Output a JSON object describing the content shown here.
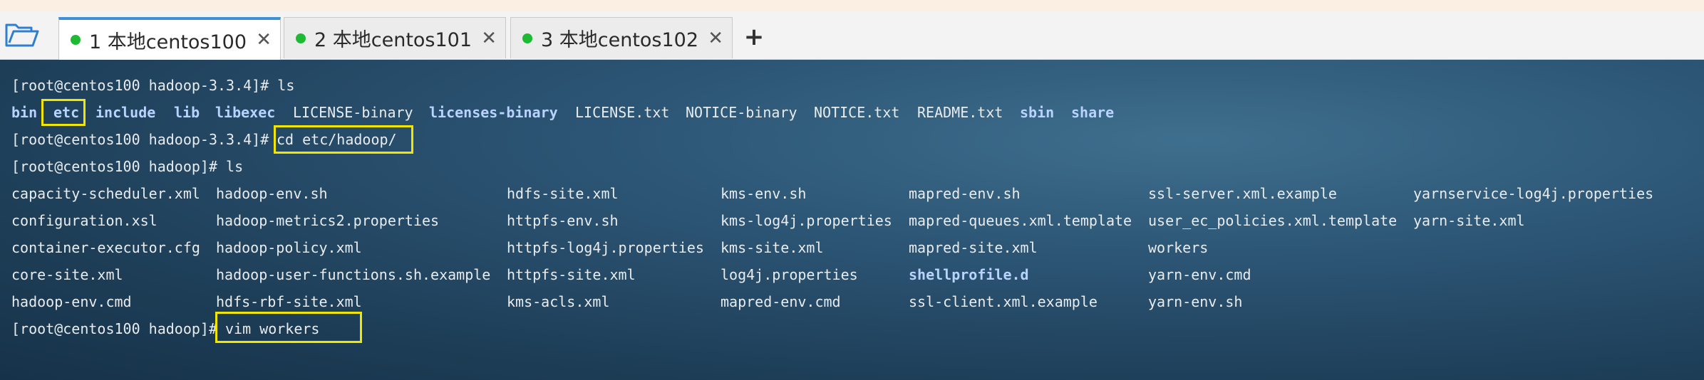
{
  "tabs": [
    {
      "label": "1 本地centos100",
      "active": true,
      "status_color": "#1eba33"
    },
    {
      "label": "2 本地centos101",
      "active": false,
      "status_color": "#1eba33"
    },
    {
      "label": "3 本地centos102",
      "active": false,
      "status_color": "#1eba33"
    }
  ],
  "tab_close_glyph": "✕",
  "add_tab_glyph": "+",
  "terminal": {
    "line1": "[root@centos100 hadoop-3.3.4]# ls",
    "ls1": [
      "bin",
      "etc",
      "include",
      "lib",
      "libexec",
      "LICENSE-binary",
      "licenses-binary",
      "LICENSE.txt",
      "NOTICE-binary",
      "NOTICE.txt",
      "README.txt",
      "sbin",
      "share"
    ],
    "line3_prompt": "[root@centos100 hadoop-3.3.4]#",
    "line3_cmd": "cd etc/hadoop/",
    "line4": "[root@centos100 hadoop]# ls",
    "ls2": [
      [
        "capacity-scheduler.xml",
        "hadoop-env.sh",
        "hdfs-site.xml",
        "kms-env.sh",
        "mapred-env.sh",
        "ssl-server.xml.example",
        "yarnservice-log4j.properties"
      ],
      [
        "configuration.xsl",
        "hadoop-metrics2.properties",
        "httpfs-env.sh",
        "kms-log4j.properties",
        "mapred-queues.xml.template",
        "user_ec_policies.xml.template",
        "yarn-site.xml"
      ],
      [
        "container-executor.cfg",
        "hadoop-policy.xml",
        "httpfs-log4j.properties",
        "kms-site.xml",
        "mapred-site.xml",
        "workers",
        ""
      ],
      [
        "core-site.xml",
        "hadoop-user-functions.sh.example",
        "httpfs-site.xml",
        "log4j.properties",
        "shellprofile.d",
        "yarn-env.cmd",
        ""
      ],
      [
        "hadoop-env.cmd",
        "hdfs-rbf-site.xml",
        "kms-acls.xml",
        "mapred-env.cmd",
        "ssl-client.xml.example",
        "yarn-env.sh",
        ""
      ]
    ],
    "line10_prompt": "[root@centos100 hadoop]#",
    "line10_cmd": "vim workers"
  },
  "colors": {
    "directory_text": "#b9d3ff",
    "highlight_box": "#f2e600",
    "active_tab_accent": "#3d8fd6"
  },
  "icons": {
    "folder": "open-folder-icon",
    "close": "close-icon",
    "add": "plus-icon"
  }
}
